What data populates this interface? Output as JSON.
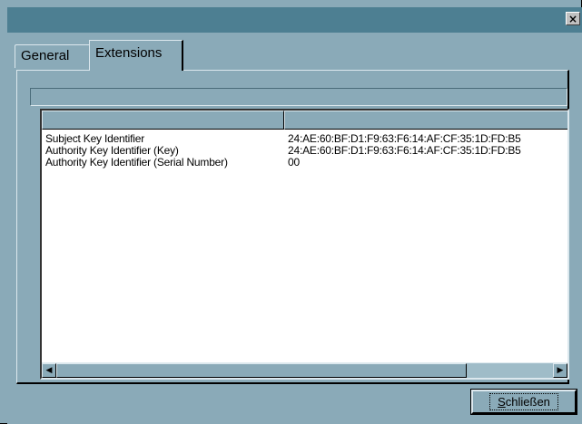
{
  "window": {
    "title": "",
    "close_glyph": "×"
  },
  "tabs": [
    {
      "label": "General",
      "active": false
    },
    {
      "label": "Extensions",
      "active": true
    }
  ],
  "extensions_list": {
    "columns": [
      "",
      ""
    ],
    "rows": [
      {
        "name": "Subject Key Identifier",
        "value": "24:AE:60:BF:D1:F9:63:F6:14:AF:CF:35:1D:FD:B5"
      },
      {
        "name": "Authority Key Identifier (Key)",
        "value": "24:AE:60:BF:D1:F9:63:F6:14:AF:CF:35:1D:FD:B5"
      },
      {
        "name": "Authority Key Identifier (Serial Number)",
        "value": "00"
      }
    ]
  },
  "scrollbar": {
    "left_arrow": "◀",
    "right_arrow": "▶",
    "position": 0
  },
  "buttons": {
    "close_label": "Schließen",
    "close_mnemonic": "S"
  },
  "colors": {
    "window_bg": "#8aaab8",
    "titlebar": "#4d7f92",
    "list_bg": "#ffffff"
  }
}
